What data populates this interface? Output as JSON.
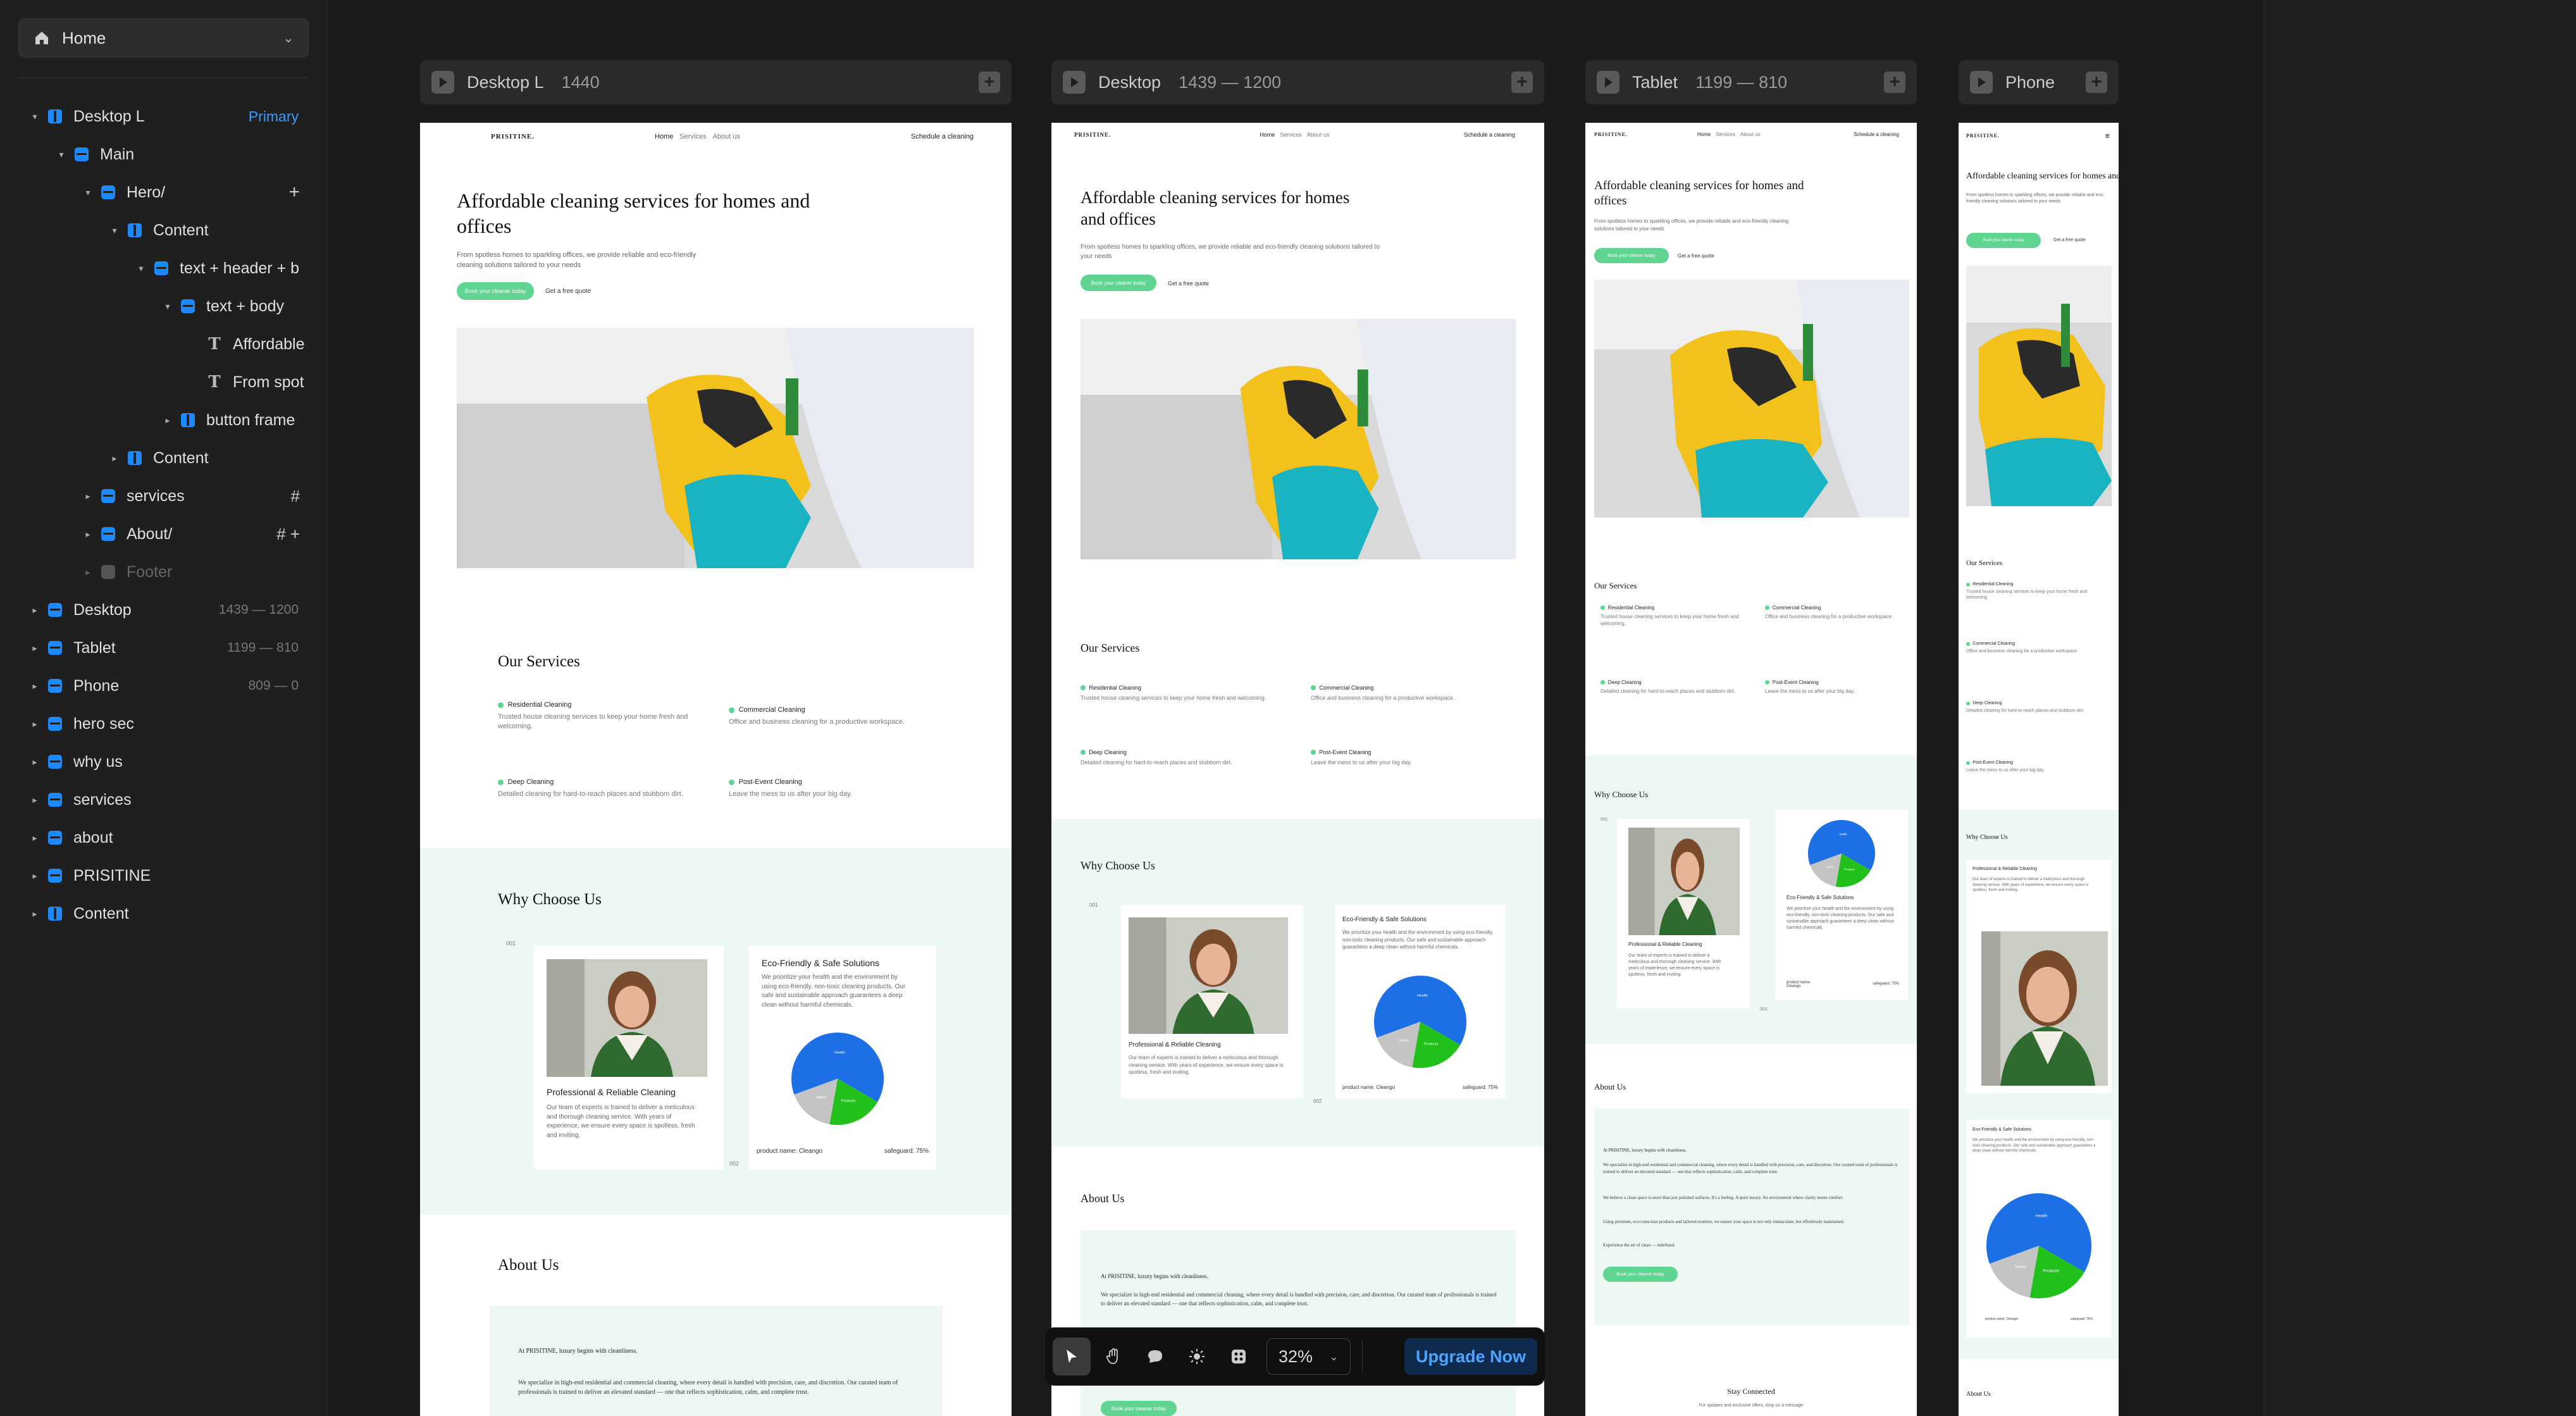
{
  "sidebar": {
    "page_select": "Home",
    "layers": [
      {
        "label": "Desktop L",
        "meta": "Primary"
      },
      {
        "label": "Main",
        "meta": ""
      },
      {
        "label": "Hero/",
        "meta": "+"
      },
      {
        "label": "Content",
        "meta": ""
      },
      {
        "label": "text + header + b",
        "meta": ""
      },
      {
        "label": "text + body",
        "meta": ""
      },
      {
        "label": "Affordable",
        "meta": ""
      },
      {
        "label": "From spot",
        "meta": ""
      },
      {
        "label": "button frame",
        "meta": ""
      },
      {
        "label": "Content",
        "meta": ""
      },
      {
        "label": "services",
        "meta": "#"
      },
      {
        "label": "About/",
        "meta": "# +"
      },
      {
        "label": "Footer",
        "meta": ""
      },
      {
        "label": "Desktop",
        "meta": "1439 — 1200"
      },
      {
        "label": "Tablet",
        "meta": "1199 — 810"
      },
      {
        "label": "Phone",
        "meta": "809 — 0"
      },
      {
        "label": "hero sec",
        "meta": ""
      },
      {
        "label": "why us",
        "meta": ""
      },
      {
        "label": "services",
        "meta": ""
      },
      {
        "label": "about",
        "meta": ""
      },
      {
        "label": "PRISITINE",
        "meta": ""
      },
      {
        "label": "Content",
        "meta": ""
      }
    ]
  },
  "breakpoints": [
    {
      "name": "Desktop L",
      "range": "1440"
    },
    {
      "name": "Desktop",
      "range": "1439 — 1200"
    },
    {
      "name": "Tablet",
      "range": "1199 — 810"
    },
    {
      "name": "Phone",
      "range": ""
    }
  ],
  "site": {
    "logo": "PRISITINE.",
    "nav": [
      "Home",
      "Services",
      "About us"
    ],
    "nav_cta": "Schedule a cleaning",
    "hero_title": "Affordable cleaning services for homes and offices",
    "hero_sub": "From spotless homes to sparkling offices, we provide reliable and eco-friendly cleaning solutions tailored to your needs",
    "btn_primary": "Book your cleaner today",
    "btn_secondary": "Get a free quote",
    "services_title": "Our Services",
    "services": [
      {
        "title": "Residential Cleaning",
        "desc": "Trusted house cleaning services to keep your home fresh and welcoming."
      },
      {
        "title": "Commercial Cleaning",
        "desc": "Office and business cleaning for a productive workspace."
      },
      {
        "title": "Deep Cleaning",
        "desc": "Detailed cleaning for hard-to-reach places and stubborn dirt."
      },
      {
        "title": "Post-Event Cleaning",
        "desc": "Leave the mess to us after your big day."
      }
    ],
    "why_title": "Why Choose Us",
    "why_num1": "001",
    "why_num2": "002",
    "card1_title": "Professional & Reliable Cleaning",
    "card1_text": "Our team of experts is trained to deliver a meticulous and thorough cleaning service. With years of experience, we ensure every space is spotless, fresh and inviting.",
    "card2_title": "Eco-Friendly & Safe Solutions",
    "card2_text": "We prioritize your health and the environment by using eco-friendly, non-toxic cleaning products. Our safe and sustainable approach guarantees a deep clean without harmful chemicals.",
    "product_name": "product name: Cleango",
    "safeguard": "safeguard: 75%",
    "pie_labels": [
      "Health",
      "Products",
      "Safety"
    ],
    "about_title": "About Us",
    "about_lead": "At PRISITINE, luxury begins with cleanliness.",
    "about_p1": "We specialize in high-end residential and commercial cleaning, where every detail is handled with precision, care, and discretion. Our curated team of professionals is trained to deliver an elevated standard — one that reflects sophistication, calm, and complete trust.",
    "about_p2": "We believe a clean space is more than just polished surfaces. It's a feeling. A quiet luxury. An environment where clarity meets comfort.",
    "about_p3": "Using premium, eco-conscious products and tailored routines, we ensure your space is not only immaculate, but effortlessly maintained.",
    "about_p4": "Experience the art of clean — redefined.",
    "stay_title": "Stay Connected",
    "stay_sub": "For updates and exclusive offers, drop us a message"
  },
  "toolbar": {
    "zoom": "32%",
    "upgrade": "Upgrade Now"
  },
  "colors": {
    "accent": "#5fd591",
    "mint": "#eef8f2",
    "blue": "#1e88ff",
    "pie_blue": "#1d6fe6",
    "pie_green": "#22c01a",
    "pie_grey": "#c4c4c4"
  }
}
